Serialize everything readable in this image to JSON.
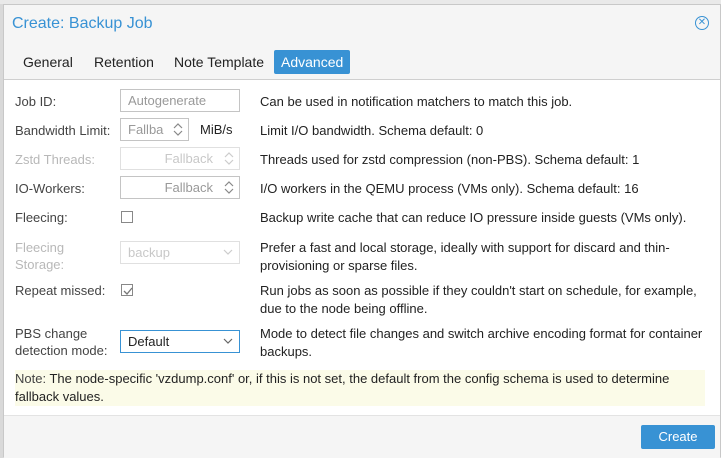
{
  "dialog": {
    "title": "Create: Backup Job"
  },
  "tabs": [
    {
      "label": "General"
    },
    {
      "label": "Retention"
    },
    {
      "label": "Note Template"
    },
    {
      "label": "Advanced"
    }
  ],
  "active_tab": "Advanced",
  "fields": {
    "job_id": {
      "label": "Job ID:",
      "placeholder": "Autogenerate",
      "description": "Can be used in notification matchers to match this job."
    },
    "bandwidth": {
      "label": "Bandwidth Limit:",
      "value": "Fallba",
      "unit": "MiB/s",
      "description": "Limit I/O bandwidth. Schema default: 0"
    },
    "zstd": {
      "label": "Zstd Threads:",
      "value": "Fallback",
      "description": "Threads used for zstd compression (non-PBS). Schema default: 1"
    },
    "io_workers": {
      "label": "IO-Workers:",
      "value": "Fallback",
      "description": "I/O workers in the QEMU process (VMs only). Schema default: 16"
    },
    "fleecing": {
      "label": "Fleecing:",
      "checked": false,
      "description": "Backup write cache that can reduce IO pressure inside guests (VMs only)."
    },
    "fleecing_storage": {
      "label_line1": "Fleecing",
      "label_line2": "Storage:",
      "value": "backup",
      "description": "Prefer a fast and local storage, ideally with support for discard and thin-provisioning or sparse files."
    },
    "repeat_missed": {
      "label": "Repeat missed:",
      "checked": true,
      "description": "Run jobs as soon as possible if they couldn't start on schedule, for example, due to the node being offline."
    },
    "pbs_mode": {
      "label_line1": "PBS change",
      "label_line2": "detection mode:",
      "value": "Default",
      "description": "Mode to detect file changes and switch archive encoding format for container backups."
    }
  },
  "note": {
    "label": "Note:",
    "text": " The node-specific 'vzdump.conf' or, if this is not set, the default from the config schema is used to determine fallback values."
  },
  "footer": {
    "create_label": "Create"
  },
  "colors": {
    "accent": "#3892d4"
  }
}
